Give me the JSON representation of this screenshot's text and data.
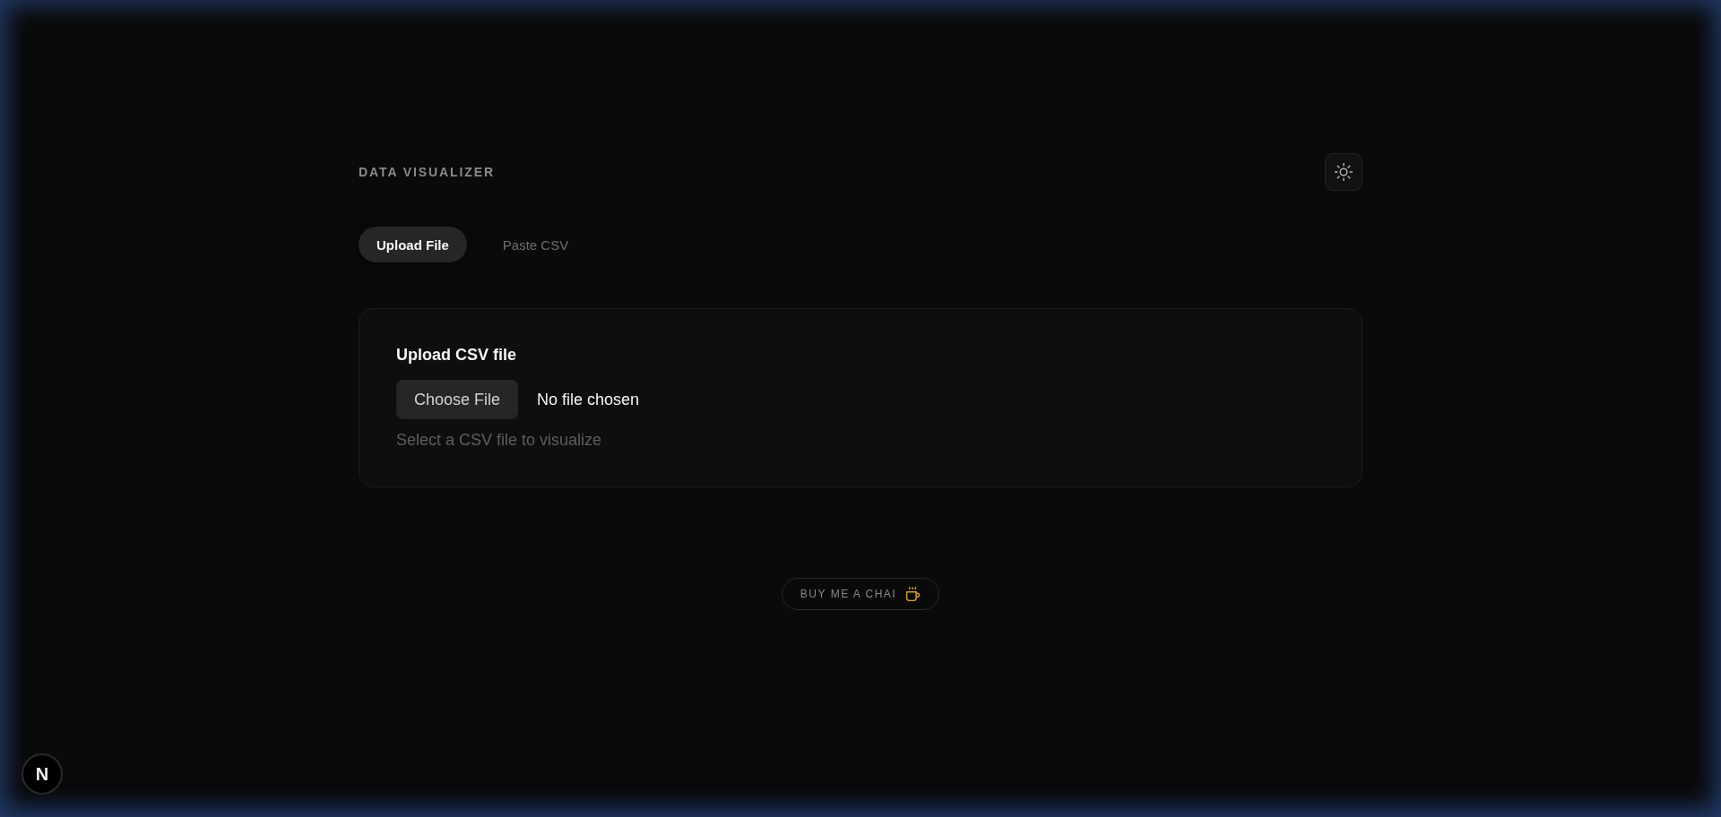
{
  "header": {
    "title": "DATA VISUALIZER"
  },
  "tabs": [
    {
      "label": "Upload File",
      "selected": true
    },
    {
      "label": "Paste CSV",
      "selected": false
    }
  ],
  "upload_card": {
    "label": "Upload CSV file",
    "file_button": "Choose File",
    "file_status": "No file chosen",
    "hint": "Select a CSV file to visualize"
  },
  "support_button": {
    "label": "BUY ME A CHAI"
  },
  "dev_badge": {
    "label": "N"
  }
}
